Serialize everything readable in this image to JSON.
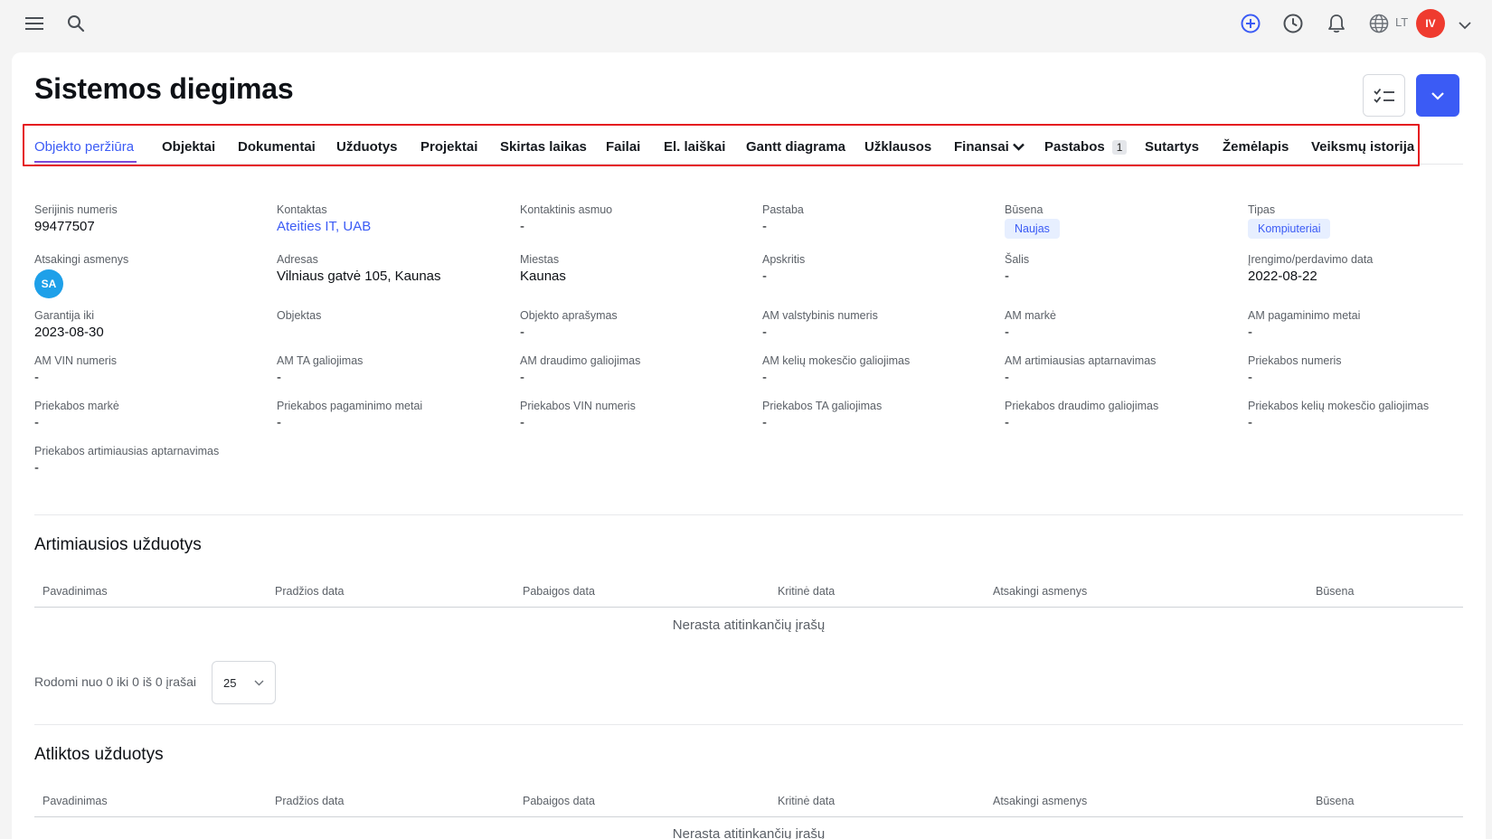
{
  "topbar": {
    "menu_icon": "hamburger-icon",
    "search_icon": "search-icon",
    "add_icon": "plus-circle-icon",
    "history_icon": "clock-icon",
    "notifications_icon": "bell-icon",
    "language_icon": "globe-icon",
    "language": "LT",
    "user_initials": "IV"
  },
  "page": {
    "title": "Sistemos diegimas"
  },
  "tabs": [
    {
      "label": "Objekto peržiūra",
      "active": true
    },
    {
      "label": "Objektai"
    },
    {
      "label": "Dokumentai"
    },
    {
      "label": "Užduotys"
    },
    {
      "label": "Projektai"
    },
    {
      "label": "Skirtas laikas"
    },
    {
      "label": "Failai"
    },
    {
      "label": "El. laiškai"
    },
    {
      "label": "Gantt diagrama"
    },
    {
      "label": "Užklausos"
    },
    {
      "label": "Finansai"
    },
    {
      "label": "Pastabos",
      "badge": "1"
    },
    {
      "label": "Sutartys"
    },
    {
      "label": "Žemėlapis"
    },
    {
      "label": "Veiksmų istorija"
    }
  ],
  "fields": {
    "serial": {
      "label": "Serijinis numeris",
      "value": "99477507"
    },
    "contact": {
      "label": "Kontaktas",
      "value": "Ateities IT, UAB"
    },
    "contact_person": {
      "label": "Kontaktinis asmuo",
      "value": "-"
    },
    "note": {
      "label": "Pastaba",
      "value": "-"
    },
    "status": {
      "label": "Būsena",
      "value": "Naujas"
    },
    "type": {
      "label": "Tipas",
      "value": "Kompiuteriai"
    },
    "responsible": {
      "label": "Atsakingi asmenys",
      "value": "SA"
    },
    "address": {
      "label": "Adresas",
      "value": "Vilniaus gatvė 105, Kaunas"
    },
    "city": {
      "label": "Miestas",
      "value": "Kaunas"
    },
    "county": {
      "label": "Apskritis",
      "value": "-"
    },
    "country": {
      "label": "Šalis",
      "value": "-"
    },
    "install_date": {
      "label": "Įrengimo/perdavimo data",
      "value": "2022-08-22"
    },
    "warranty": {
      "label": "Garantija iki",
      "value": "2023-08-30"
    },
    "object": {
      "label": "Objektas",
      "value": ""
    },
    "object_desc": {
      "label": "Objekto aprašymas",
      "value": "-"
    },
    "am_plate": {
      "label": "AM valstybinis numeris",
      "value": "-"
    },
    "am_make": {
      "label": "AM markė",
      "value": "-"
    },
    "am_year": {
      "label": "AM pagaminimo metai",
      "value": "-"
    },
    "am_vin": {
      "label": "AM VIN numeris",
      "value": "-"
    },
    "am_ta": {
      "label": "AM TA galiojimas",
      "value": "-"
    },
    "am_insurance": {
      "label": "AM draudimo galiojimas",
      "value": "-"
    },
    "am_road_tax": {
      "label": "AM kelių mokesčio galiojimas",
      "value": "-"
    },
    "am_service": {
      "label": "AM artimiausias aptarnavimas",
      "value": "-"
    },
    "trailer_number": {
      "label": "Priekabos numeris",
      "value": "-"
    },
    "trailer_make": {
      "label": "Priekabos markė",
      "value": "-"
    },
    "trailer_year": {
      "label": "Priekabos pagaminimo metai",
      "value": "-"
    },
    "trailer_vin": {
      "label": "Priekabos VIN numeris",
      "value": "-"
    },
    "trailer_ta": {
      "label": "Priekabos TA galiojimas",
      "value": "-"
    },
    "trailer_insurance": {
      "label": "Priekabos draudimo galiojimas",
      "value": "-"
    },
    "trailer_road_tax": {
      "label": "Priekabos kelių mokesčio galiojimas",
      "value": "-"
    },
    "trailer_service": {
      "label": "Priekabos artimiausias aptarnavimas",
      "value": "-"
    }
  },
  "upcoming": {
    "title": "Artimiausios užduotys",
    "columns": [
      "Pavadinimas",
      "Pradžios data",
      "Pabaigos data",
      "Kritinė data",
      "Atsakingi asmenys",
      "Būsena"
    ],
    "empty": "Nerasta atitinkančių įrašų",
    "pager_text": "Rodomi nuo 0 iki 0 iš 0 įrašai",
    "page_size": "25"
  },
  "completed": {
    "title": "Atliktos užduotys",
    "columns": [
      "Pavadinimas",
      "Pradžios data",
      "Pabaigos data",
      "Kritinė data",
      "Atsakingi asmenys",
      "Būsena"
    ],
    "empty": "Nerasta atitinkančių įrašų"
  },
  "colors": {
    "accent": "#3b5bf5",
    "tab_underline": "#7a4ad9",
    "highlight_box": "#e5171f",
    "user_avatar": "#ef3b2f",
    "responsible_avatar": "#1ea0e9"
  }
}
